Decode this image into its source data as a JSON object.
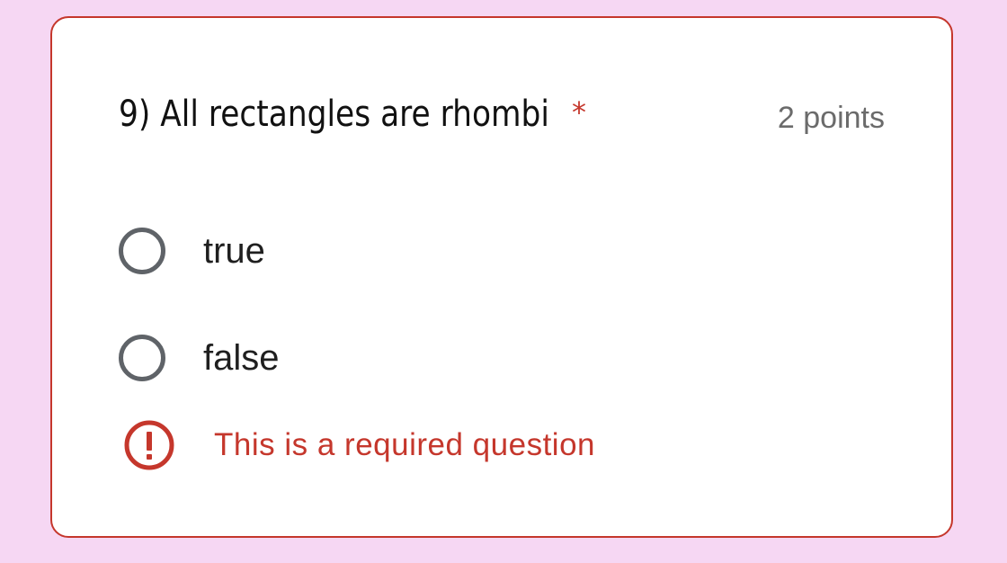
{
  "question": {
    "title": "9) All rectangles are rhombi",
    "required_marker": "*",
    "points": "2 points"
  },
  "options": [
    {
      "label": "true",
      "selected": false
    },
    {
      "label": "false",
      "selected": false
    }
  ],
  "validation": {
    "message": "This is a required question",
    "icon": "error-icon"
  },
  "colors": {
    "background": "#f6d7f3",
    "error": "#c5372c",
    "radio_border": "#5f6368",
    "points_text": "#6b6b6b"
  }
}
